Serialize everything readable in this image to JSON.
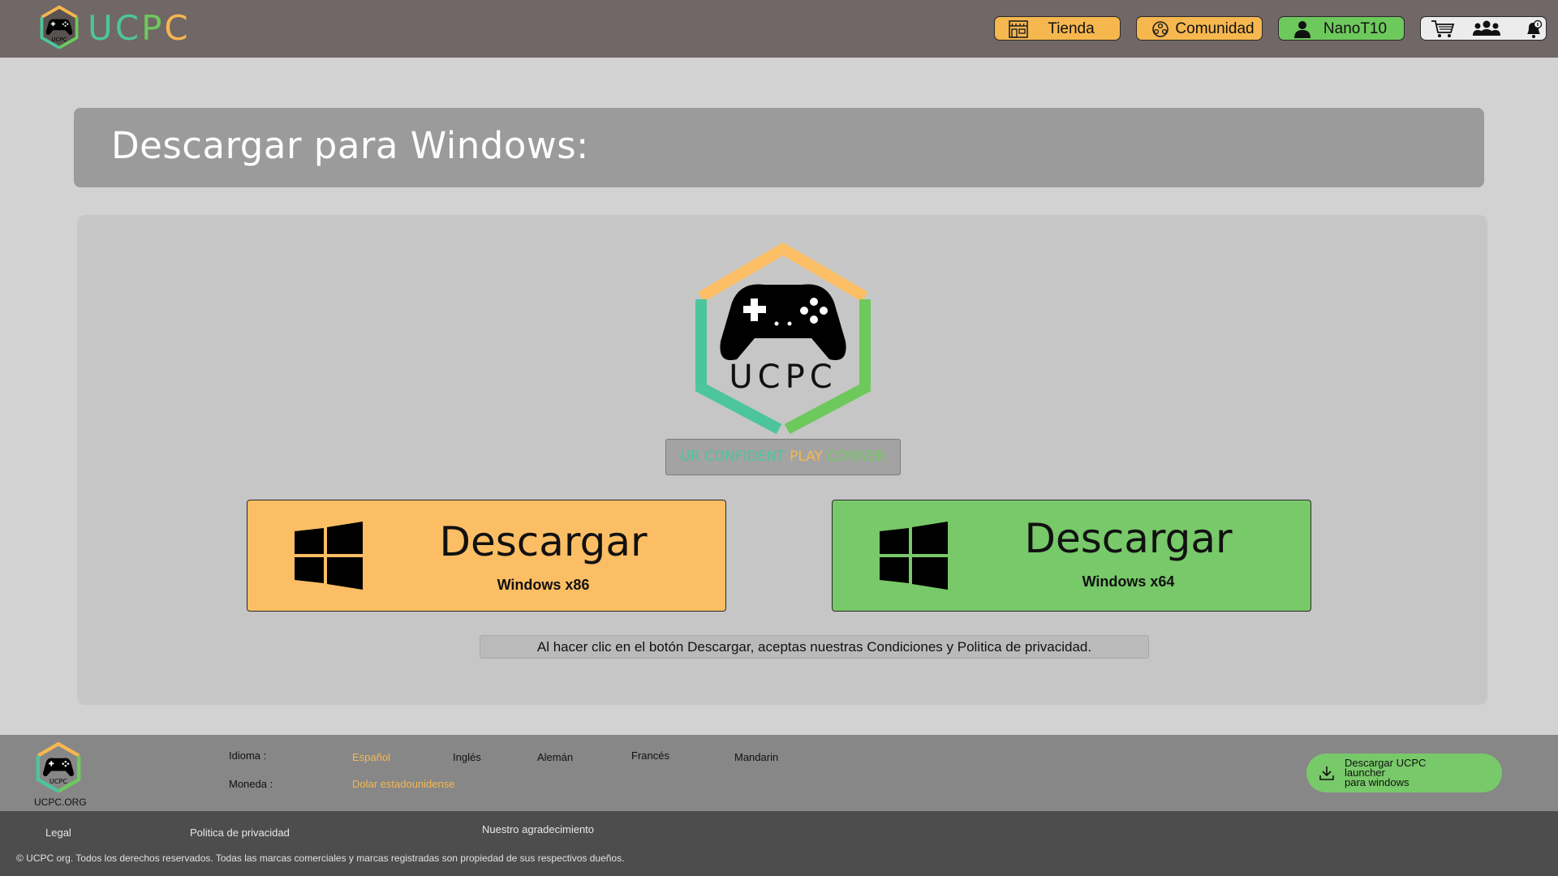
{
  "brand": {
    "name_letters": [
      "U",
      "C",
      "P",
      "C"
    ],
    "logo_text": "UCPC",
    "colors": {
      "teal": "#4cc59d",
      "orange": "#f6b74f",
      "green": "#6ec95d"
    }
  },
  "nav": {
    "store": {
      "label": "Tienda",
      "icon": "store-icon"
    },
    "community": {
      "label": "Comunidad",
      "icon": "community-icon"
    },
    "user": {
      "label": "NanoT10",
      "icon": "user-icon"
    },
    "icons": [
      "cart-icon",
      "friends-icon",
      "notifications-icon"
    ]
  },
  "page": {
    "title": "Descargar para Windows:",
    "logo_text": "UCPC",
    "tagline": {
      "part1": "UR CONFIDENT",
      "part2": "PLAY",
      "part3": "CORNER"
    },
    "downloads": [
      {
        "label": "Descargar",
        "sub": "Windows x86",
        "color": "#fcbe64"
      },
      {
        "label": "Descargar",
        "sub": "Windows x64",
        "color": "#78c969"
      }
    ],
    "terms": "Al hacer clic en el botón Descargar, aceptas nuestras Condiciones y Politica de privacidad."
  },
  "footer": {
    "org": "UCPC.ORG",
    "logo_text": "UCPC",
    "language_label": "Idioma :",
    "languages": [
      "Español",
      "Inglés",
      "Alemán",
      "Francés",
      "Mandarin"
    ],
    "selected_language": "Español",
    "currency_label": "Moneda :",
    "currency": "Dolar estadounidense",
    "launcher": {
      "line1": "Descargar UCPC",
      "line2": "launcher",
      "line3": "para windows"
    },
    "links": [
      "Legal",
      "Politica de privacidad",
      "Nuestro agradecimiento"
    ],
    "copyright": "© UCPC org. Todos los derechos reservados. Todas las marcas comerciales y marcas registradas son propiedad de sus respectivos dueños."
  }
}
